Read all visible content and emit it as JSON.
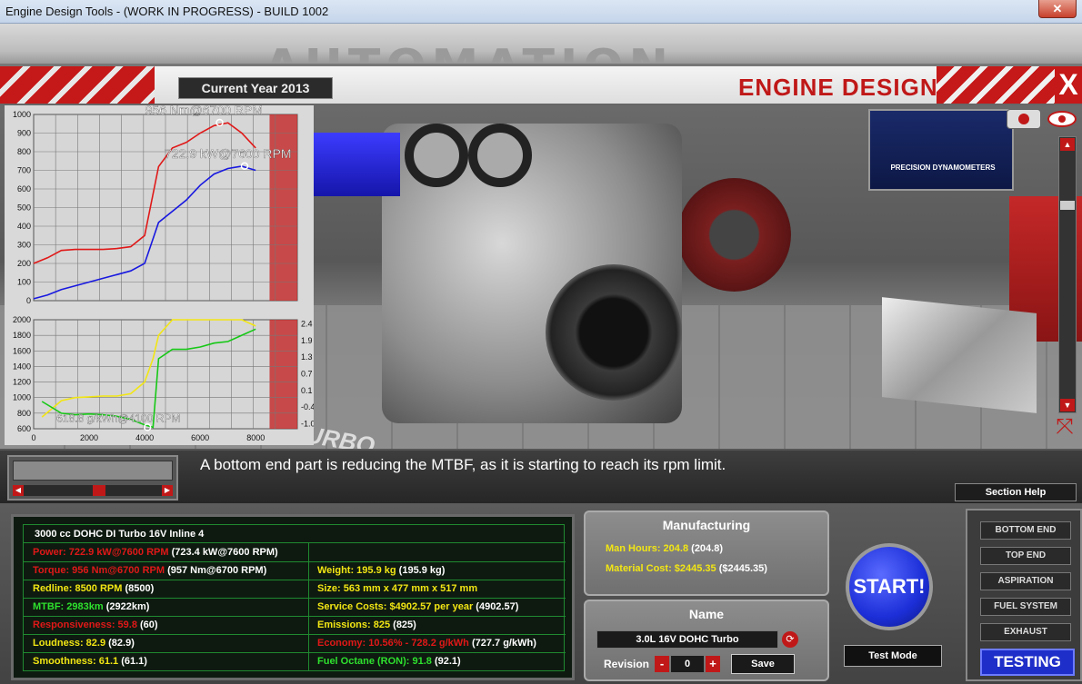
{
  "window": {
    "title": "Engine Design Tools - (WORK IN PROGRESS) - BUILD 1002"
  },
  "header": {
    "current_year": "Current Year 2013",
    "title": "ENGINE DESIGN",
    "close_label": "X"
  },
  "scene": {
    "poster_text": "PRECISION DYNAMOMETERS",
    "turbo_text": "TURBO"
  },
  "chart_data": [
    {
      "type": "line",
      "x": [
        0,
        500,
        1000,
        1500,
        2000,
        2500,
        3000,
        3500,
        4000,
        4500,
        5000,
        5500,
        6000,
        6500,
        7000,
        7500,
        8000
      ],
      "series": [
        {
          "name": "",
          "color": "#e01818",
          "values": [
            200,
            230,
            270,
            275,
            275,
            275,
            280,
            290,
            350,
            720,
            820,
            850,
            900,
            940,
            955,
            900,
            820
          ]
        },
        {
          "name": "",
          "color": "#1818e0",
          "values": [
            10,
            30,
            60,
            80,
            100,
            120,
            140,
            160,
            200,
            420,
            480,
            540,
            620,
            680,
            710,
            722,
            700
          ]
        }
      ],
      "ylim": [
        0,
        1000
      ],
      "yticks": [
        "0",
        "100",
        "200",
        "300",
        "400",
        "500",
        "600",
        "700",
        "800",
        "900",
        "1000"
      ],
      "annotations": [
        {
          "text": "956 Nm@6700 RPM",
          "x": 6700,
          "y": 956
        },
        {
          "text": "722.9 kW@7600 RPM",
          "x": 7600,
          "y": 722.9
        }
      ],
      "grid": true
    },
    {
      "type": "line",
      "x": [
        300,
        1000,
        1500,
        2000,
        2500,
        3000,
        3500,
        4000,
        4300,
        4500,
        5000,
        5500,
        6000,
        6500,
        7000,
        7500,
        8000
      ],
      "series": [
        {
          "name": "",
          "color": "#f2e614",
          "values": [
            750,
            960,
            1000,
            1010,
            1020,
            1020,
            1050,
            1200,
            1500,
            1800,
            2000,
            2000,
            2000,
            2000,
            2000,
            2000,
            1920
          ]
        },
        {
          "name": "",
          "color": "#16c816",
          "values": [
            950,
            800,
            780,
            790,
            780,
            760,
            720,
            650,
            619,
            1500,
            1620,
            1620,
            1650,
            1700,
            1720,
            1800,
            1880
          ]
        }
      ],
      "xticks": [
        "0",
        "2000",
        "4000",
        "6000",
        "8000"
      ],
      "ylim": [
        600,
        2000
      ],
      "yticks": [
        "600",
        "800",
        "1000",
        "1200",
        "1400",
        "1600",
        "1800",
        "2000"
      ],
      "y2ticks": [
        "-1.0",
        "-0.4",
        "0.1",
        "0.7",
        "1.3",
        "1.9",
        "2.4"
      ],
      "annotations": [
        {
          "text": "618.8 g/kWh@4100 RPM",
          "x": 4100,
          "y": 618.8
        }
      ],
      "grid": true
    }
  ],
  "message": "A bottom end part is reducing the MTBF, as it is starting to reach its rpm limit.",
  "section_help": "Section Help",
  "stats": {
    "engine_name": "3000 cc DOHC DI Turbo 16V Inline 4",
    "left": [
      {
        "label": "Power: 722.9 kW@7600 RPM",
        "prev": "(723.4 kW@7600 RPM)",
        "color": "red"
      },
      {
        "label": "Torque: 956 Nm@6700 RPM",
        "prev": "(957 Nm@6700 RPM)",
        "color": "red"
      },
      {
        "label": "Redline: 8500 RPM",
        "prev": "(8500)",
        "color": "yellow"
      },
      {
        "label": "MTBF: 2983km",
        "prev": "(2922km)",
        "color": "green"
      },
      {
        "label": "Responsiveness: 59.8",
        "prev": "(60)",
        "color": "red"
      },
      {
        "label": "Loudness: 82.9",
        "prev": "(82.9)",
        "color": "yellow"
      },
      {
        "label": "Smoothness: 61.1",
        "prev": "(61.1)",
        "color": "yellow"
      }
    ],
    "right": [
      {
        "label": "",
        "prev": "",
        "color": "yellow"
      },
      {
        "label": "Weight: 195.9 kg",
        "prev": "(195.9 kg)",
        "color": "yellow"
      },
      {
        "label": "Size: 563 mm x 477 mm x 517 mm",
        "prev": "",
        "color": "yellow"
      },
      {
        "label": "Service Costs: $4902.57 per year",
        "prev": "(4902.57)",
        "color": "yellow"
      },
      {
        "label": "Emissions: 825",
        "prev": "(825)",
        "color": "yellow"
      },
      {
        "label": "Economy: 10.56% - 728.2 g/kWh",
        "prev": "(727.7 g/kWh)",
        "color": "red"
      },
      {
        "label": "Fuel Octane (RON): 91.8",
        "prev": "(92.1)",
        "color": "green"
      }
    ]
  },
  "manufacturing": {
    "title": "Manufacturing",
    "man_hours": "Man Hours: 204.8",
    "man_hours_prev": "(204.8)",
    "material_cost": "Material Cost: $2445.35",
    "material_cost_prev": "($2445.35)"
  },
  "name_panel": {
    "title": "Name",
    "name_value": "3.0L 16V DOHC Turbo",
    "revision_label": "Revision",
    "revision_value": "0",
    "save_label": "Save",
    "minus": "-",
    "plus": "+"
  },
  "start_label": "START!",
  "test_mode_label": "Test Mode",
  "tabs": [
    "BOTTOM END",
    "TOP END",
    "ASPIRATION",
    "FUEL SYSTEM",
    "EXHAUST"
  ],
  "testing_label": "TESTING",
  "colors": {
    "accent_red": "#c51818",
    "start_blue": "#1c2fd8",
    "stat_green": "#1f8a2f"
  }
}
